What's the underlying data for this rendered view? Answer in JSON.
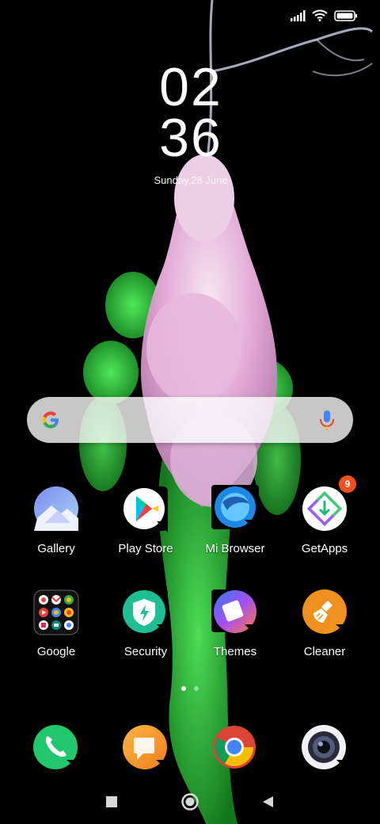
{
  "status_bar": {
    "icons": [
      "signal-icon",
      "wifi-icon",
      "battery-icon"
    ]
  },
  "clock": {
    "hour": "02",
    "minute": "36",
    "date": "Sunday,28 June"
  },
  "search": {
    "icons": [
      "google-logo-icon",
      "microphone-icon"
    ]
  },
  "apps_row1": [
    {
      "label": "Gallery"
    },
    {
      "label": "Play Store"
    },
    {
      "label": "Mi Browser"
    },
    {
      "label": "GetApps",
      "badge": "9"
    }
  ],
  "apps_row2": [
    {
      "label": "Google"
    },
    {
      "label": "Security"
    },
    {
      "label": "Themes"
    },
    {
      "label": "Cleaner"
    }
  ],
  "page_indicator": {
    "pages": 2,
    "current": 1
  },
  "dock": {
    "icons": [
      "phone-icon",
      "messaging-icon",
      "chrome-icon",
      "camera-icon"
    ]
  },
  "nav": {
    "icons": [
      "recents-icon",
      "home-icon",
      "back-icon"
    ]
  },
  "colors": {
    "background": "#000000",
    "badge": "#f0501d",
    "security": "#1fbf95",
    "cleaner": "#f0901e",
    "phone": "#20c76c"
  }
}
